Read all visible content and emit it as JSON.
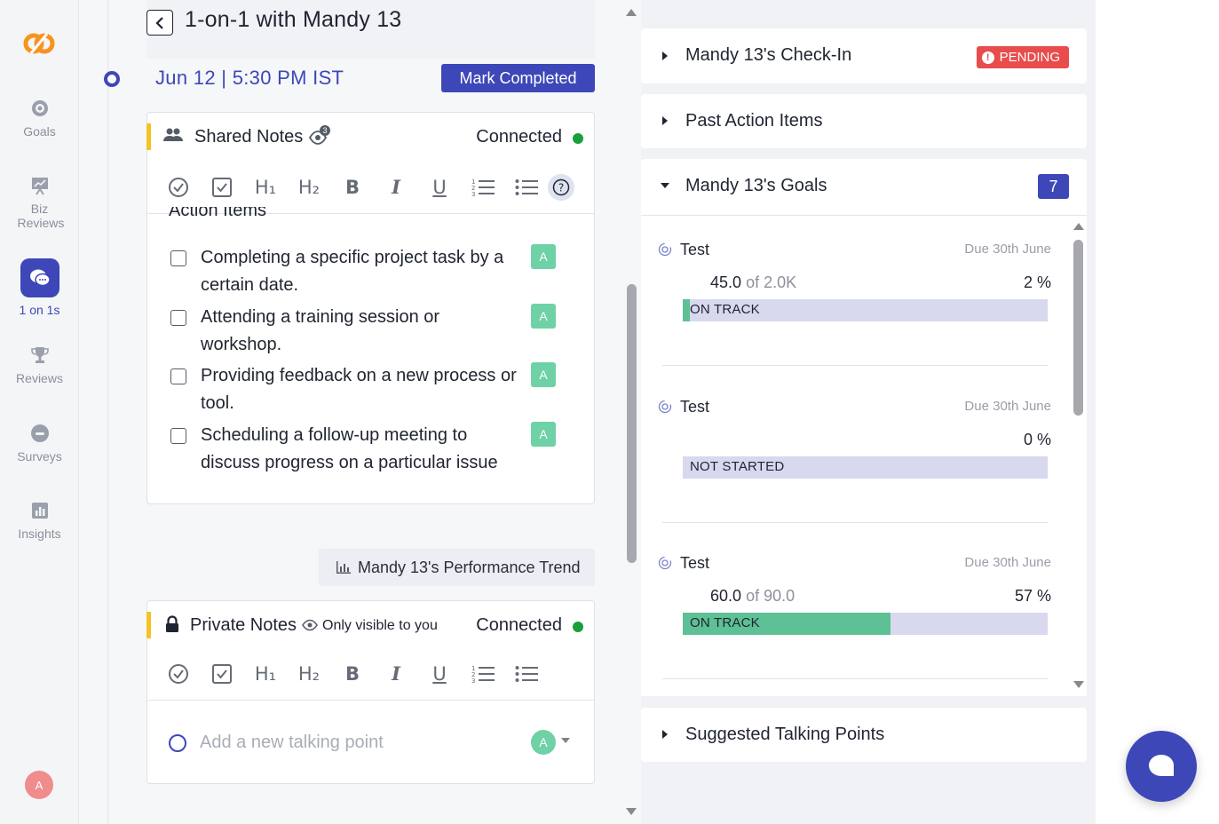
{
  "sidebar": {
    "items": [
      {
        "label": "Goals",
        "icon": "target-icon"
      },
      {
        "label": "Biz Reviews",
        "icon": "presentation-icon"
      },
      {
        "label": "1 on 1s",
        "icon": "chat-icon",
        "active": true
      },
      {
        "label": "Reviews",
        "icon": "trophy-icon"
      },
      {
        "label": "Surveys",
        "icon": "survey-icon"
      },
      {
        "label": "Insights",
        "icon": "bar-chart-icon"
      }
    ],
    "user_avatar": "A"
  },
  "meeting": {
    "title": "1-on-1 with Mandy 13",
    "date": "Jun 12",
    "separator": "|",
    "time": "5:30 PM",
    "timezone": "IST",
    "mark_completed_label": "Mark Completed"
  },
  "shared_notes": {
    "title": "Shared Notes",
    "viewers_count": "3",
    "status": "Connected",
    "section_heading": "Action Items",
    "items": [
      {
        "text": "Completing a specific project task by a certain date.",
        "assignee": "A"
      },
      {
        "text": "Attending a training session or workshop.",
        "assignee": "A"
      },
      {
        "text": "Providing feedback on a new process or tool.",
        "assignee": "A"
      },
      {
        "text": "Scheduling a follow-up meeting to discuss progress on a particular issue",
        "assignee": "A"
      }
    ]
  },
  "toolbar": {
    "h1": "H₁",
    "h2": "H₂",
    "bold": "B",
    "italic": "I",
    "underline": "U"
  },
  "performance_trend_label": "Mandy 13's Performance Trend",
  "private_notes": {
    "title": "Private Notes",
    "visibility_note": "Only visible to you",
    "status": "Connected",
    "placeholder": "Add a new talking point",
    "assignee": "A"
  },
  "right_panel": {
    "checkin": {
      "title": "Mandy 13's Check-In",
      "badge": "PENDING"
    },
    "past_actions": {
      "title": "Past Action Items"
    },
    "goals": {
      "title": "Mandy 13's Goals",
      "count": "7",
      "items": [
        {
          "name": "Test",
          "due": "Due 30th June",
          "current": "45.0",
          "of_label": "of 2.0K",
          "percent_label": "2 %",
          "progress": 2,
          "status": "ON TRACK"
        },
        {
          "name": "Test",
          "due": "Due 30th June",
          "current": "",
          "of_label": "",
          "percent_label": "0 %",
          "progress": 0,
          "status": "NOT STARTED"
        },
        {
          "name": "Test",
          "due": "Due 30th June",
          "current": "60.0",
          "of_label": "of 90.0",
          "percent_label": "57 %",
          "progress": 57,
          "status": "ON TRACK"
        }
      ]
    },
    "suggested": {
      "title": "Suggested Talking Points"
    }
  },
  "colors": {
    "brand": "#3d47b8",
    "on_track": "#5ec095",
    "pending": "#e84c4c",
    "accent_yellow": "#f5c325"
  }
}
